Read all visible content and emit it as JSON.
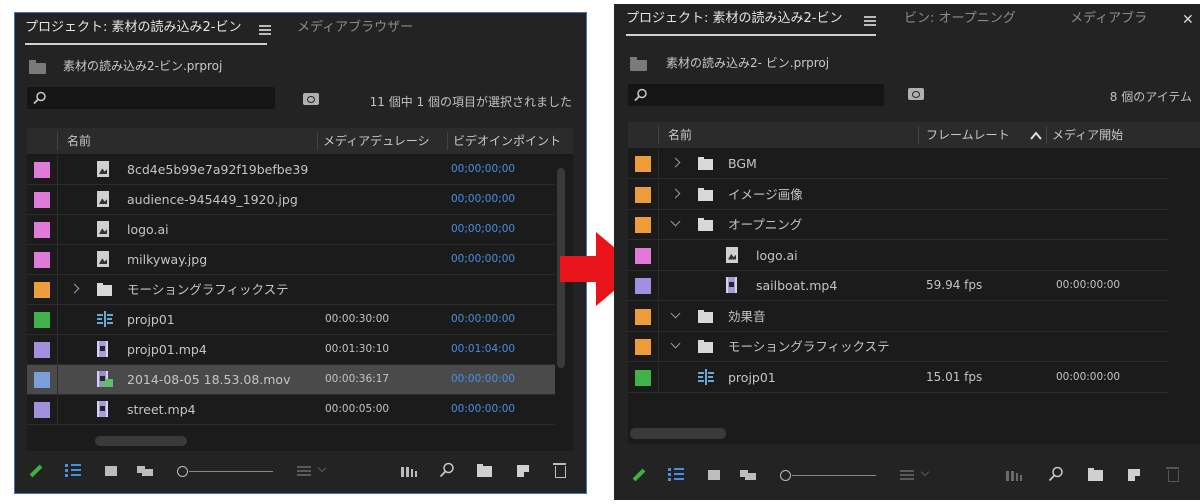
{
  "colors": {
    "panel_bg": "#232323",
    "list_bg": "#1b1b1b",
    "highlight_blue": "#4a8fe0",
    "arrow_red": "#e8141a",
    "label_pink": "#e07ad8",
    "label_orange": "#ef9d3a",
    "label_green": "#3fb24a",
    "label_lavender": "#a38fe0",
    "label_blue": "#7b9fd8"
  },
  "left": {
    "tab_project": "プロジェクト: 素材の読み込み2-ビン",
    "tab_media_browser": "メディアブラウザー",
    "menu_icon": "hamburger-icon",
    "project_file": "素材の読み込み2-ビン.prproj",
    "search_placeholder": "",
    "selection_status": "11 個中 1 個の項目が選択されました",
    "columns": {
      "name": "名前",
      "media_duration": "メディアデュレーシ",
      "video_in_point": "ビデオインポイント"
    },
    "rows": [
      {
        "label": "#e07ad8",
        "icon": "image-icon",
        "name": "8cd4e5b99e7a92f19befbe39",
        "duration": "",
        "in_point": "00;00;00;00"
      },
      {
        "label": "#e07ad8",
        "icon": "image-icon",
        "name": "audience-945449_1920.jpg",
        "duration": "",
        "in_point": "00;00;00;00"
      },
      {
        "label": "#e07ad8",
        "icon": "image-icon",
        "name": "logo.ai",
        "duration": "",
        "in_point": "00;00;00;00"
      },
      {
        "label": "#e07ad8",
        "icon": "image-icon",
        "name": "milkyway.jpg",
        "duration": "",
        "in_point": "00;00;00;00"
      },
      {
        "label": "#ef9d3a",
        "icon": "folder-icon",
        "name": "モーショングラフィックステ",
        "duration": "",
        "in_point": ""
      },
      {
        "label": "#3fb24a",
        "icon": "sequence-icon",
        "name": "projp01",
        "duration": "00:00:30:00",
        "in_point": "00:00:00:00"
      },
      {
        "label": "#a38fe0",
        "icon": "film-icon",
        "name": "projp01.mp4",
        "duration": "00:01:30:10",
        "in_point": "00:01:04:00"
      },
      {
        "label": "#7b9fd8",
        "icon": "film-icon",
        "name": "2014-08-05 18.53.08.mov",
        "duration": "00:00:36:17",
        "in_point": "00:00:00:00"
      },
      {
        "label": "#a38fe0",
        "icon": "film-icon",
        "name": "street.mp4",
        "duration": "00:00:05:00",
        "in_point": "00:00:00:00"
      }
    ]
  },
  "right": {
    "tab_project": "プロジェクト: 素材の読み込み2-ビン",
    "tab_bin": "ビン: オープニング",
    "tab_media_browser": "メディアブラ",
    "project_file": "素材の読み込み2- ビン.prproj",
    "item_count": "8 個のアイテム",
    "columns": {
      "name": "名前",
      "frame_rate": "フレームレート",
      "media_start": "メディア開始"
    },
    "rows": [
      {
        "label": "#ef9d3a",
        "expander": "right",
        "icon": "folder-icon",
        "name": "BGM",
        "fps": "",
        "start": ""
      },
      {
        "label": "#ef9d3a",
        "expander": "right",
        "icon": "folder-icon",
        "name": "イメージ画像",
        "fps": "",
        "start": ""
      },
      {
        "label": "#ef9d3a",
        "expander": "down",
        "icon": "folder-icon",
        "name": "オープニング",
        "fps": "",
        "start": ""
      },
      {
        "label": "#e07ad8",
        "expander": "",
        "icon": "image-icon",
        "name": "logo.ai",
        "fps": "",
        "start": ""
      },
      {
        "label": "#a38fe0",
        "expander": "",
        "icon": "film-icon",
        "name": "sailboat.mp4",
        "fps": "59.94 fps",
        "start": "00:00:00:00"
      },
      {
        "label": "#ef9d3a",
        "expander": "down",
        "icon": "folder-icon",
        "name": "効果音",
        "fps": "",
        "start": ""
      },
      {
        "label": "#ef9d3a",
        "expander": "down",
        "icon": "folder-icon",
        "name": "モーショングラフィックステ",
        "fps": "",
        "start": ""
      },
      {
        "label": "#3fb24a",
        "expander": "",
        "icon": "sequence-icon",
        "name": "projp01",
        "fps": "15.01 fps",
        "start": "00:00:00:00"
      }
    ]
  }
}
